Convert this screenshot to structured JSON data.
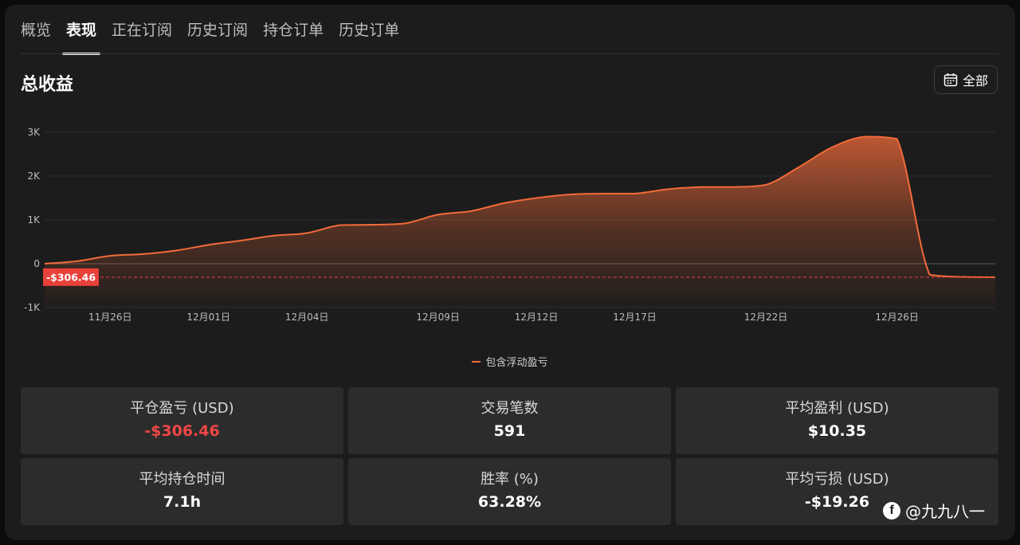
{
  "tabs": [
    {
      "label": "概览"
    },
    {
      "label": "表现"
    },
    {
      "label": "正在订阅"
    },
    {
      "label": "历史订阅"
    },
    {
      "label": "持仓订单"
    },
    {
      "label": "历史订单"
    }
  ],
  "active_tab": "表现",
  "section_title": "总收益",
  "range_button": {
    "label": "全部",
    "icon": "calendar-icon"
  },
  "chart_data": {
    "type": "area",
    "x": [
      "11月22日",
      "11月24日",
      "11月26日",
      "11月28日",
      "11月30日",
      "12月01日",
      "12月02日",
      "12月03日",
      "12月04日",
      "12月05日",
      "12月07日",
      "12月08日",
      "12月09日",
      "12月10日",
      "12月11日",
      "12月12日",
      "12月14日",
      "12月15日",
      "12月17日",
      "12月18日",
      "12月20日",
      "12月21日",
      "12月22日",
      "12月23日",
      "12月24日",
      "12月25日",
      "12月26日",
      "12月27日",
      "12月28日",
      "12月29日"
    ],
    "series": [
      {
        "name": "包含浮动盈亏",
        "color": "#f26b3a",
        "values": [
          0,
          60,
          180,
          220,
          300,
          430,
          530,
          640,
          700,
          880,
          890,
          920,
          1120,
          1200,
          1380,
          1500,
          1580,
          1600,
          1600,
          1700,
          1750,
          1750,
          1800,
          2200,
          2650,
          2900,
          2850,
          -250,
          -300,
          -306.46
        ]
      }
    ],
    "xticks": [
      "11月26日",
      "12月01日",
      "12月04日",
      "12月09日",
      "12月12日",
      "12月17日",
      "12月22日",
      "12月26日"
    ],
    "yticks": [
      -1000,
      0,
      1000,
      2000,
      3000
    ],
    "ytick_labels": [
      "-1K",
      "0",
      "1K",
      "2K",
      "3K"
    ],
    "ylim": [
      -1000,
      3000
    ],
    "grid": true,
    "legend_position": "bottom-center",
    "reference_line": {
      "value": -306.46,
      "label": "-$306.46",
      "color": "#e8413a"
    }
  },
  "stats": [
    {
      "label": "平仓盈亏 (USD)",
      "value": "-$306.46",
      "negative": true
    },
    {
      "label": "交易笔数",
      "value": "591",
      "negative": false
    },
    {
      "label": "平均盈利 (USD)",
      "value": "$10.35",
      "negative": false
    },
    {
      "label": "平均持仓时间",
      "value": "7.1h",
      "negative": false
    },
    {
      "label": "胜率 (%)",
      "value": "63.28%",
      "negative": false
    },
    {
      "label": "平均亏损 (USD)",
      "value": "-$19.26",
      "negative": false
    }
  ],
  "watermark": {
    "text": "@九九八一",
    "icon": "facebook-icon"
  }
}
